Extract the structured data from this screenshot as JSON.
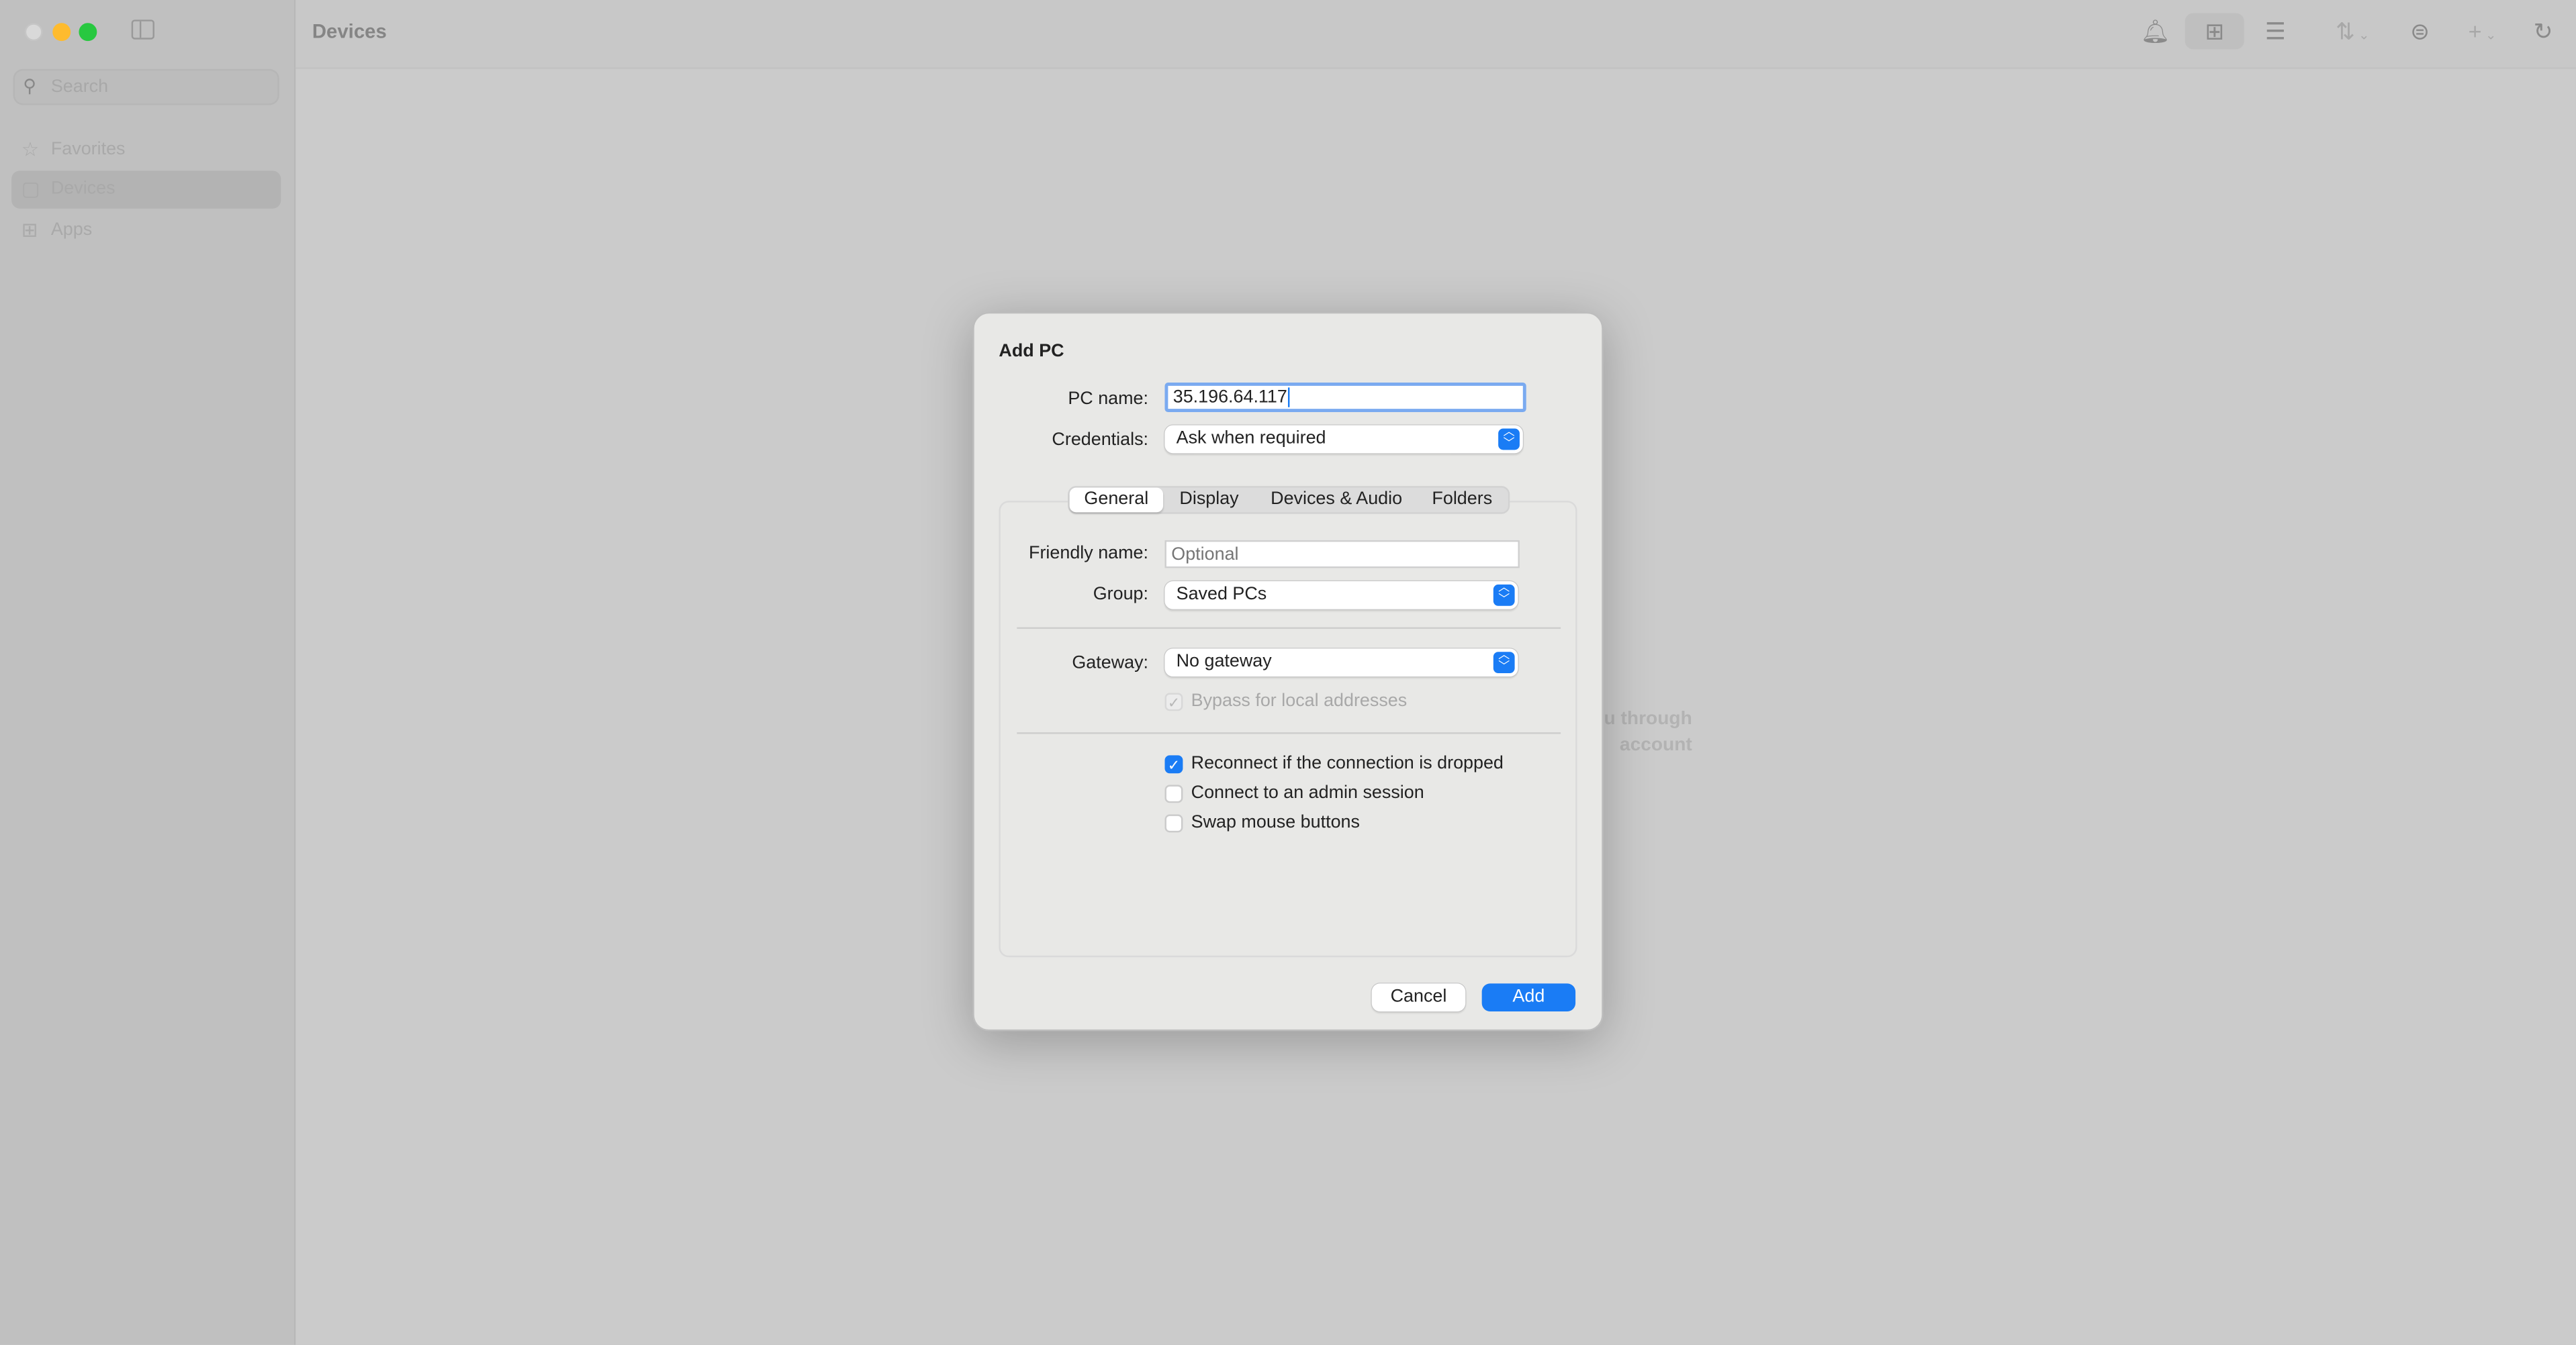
{
  "window": {
    "title": "Devices",
    "traffic_lights": {
      "close": "#d9d9d9",
      "minimize": "#febb2e",
      "zoom": "#28c840"
    }
  },
  "sidebar": {
    "search_placeholder": "Search",
    "items": [
      {
        "label": "Favorites",
        "icon": "star-icon",
        "selected": false
      },
      {
        "label": "Devices",
        "icon": "monitor-icon",
        "selected": true
      },
      {
        "label": "Apps",
        "icon": "apps-grid-icon",
        "selected": false
      }
    ]
  },
  "toolbar": {
    "icons": [
      "bell-icon",
      "grid-view-icon",
      "list-view-icon",
      "sort-icon",
      "filter-icon",
      "add-icon",
      "refresh-icon"
    ],
    "active_view": "grid"
  },
  "background_text": {
    "line1": "u through",
    "line2": "account"
  },
  "dialog": {
    "title": "Add PC",
    "pc_name_label": "PC name:",
    "pc_name_value": "35.196.64.117",
    "credentials_label": "Credentials:",
    "credentials_value": "Ask when required",
    "tabs": [
      {
        "label": "General",
        "selected": true
      },
      {
        "label": "Display",
        "selected": false
      },
      {
        "label": "Devices & Audio",
        "selected": false
      },
      {
        "label": "Folders",
        "selected": false
      }
    ],
    "friendly_name_label": "Friendly name:",
    "friendly_name_placeholder": "Optional",
    "group_label": "Group:",
    "group_value": "Saved PCs",
    "gateway_label": "Gateway:",
    "gateway_value": "No gateway",
    "bypass_label": "Bypass for local addresses",
    "bypass_checked": true,
    "options": [
      {
        "label": "Reconnect if the connection is dropped",
        "checked": true
      },
      {
        "label": "Connect to an admin session",
        "checked": false
      },
      {
        "label": "Swap mouse buttons",
        "checked": false
      }
    ],
    "cancel_label": "Cancel",
    "add_label": "Add",
    "accent": "#1a7cf5"
  }
}
